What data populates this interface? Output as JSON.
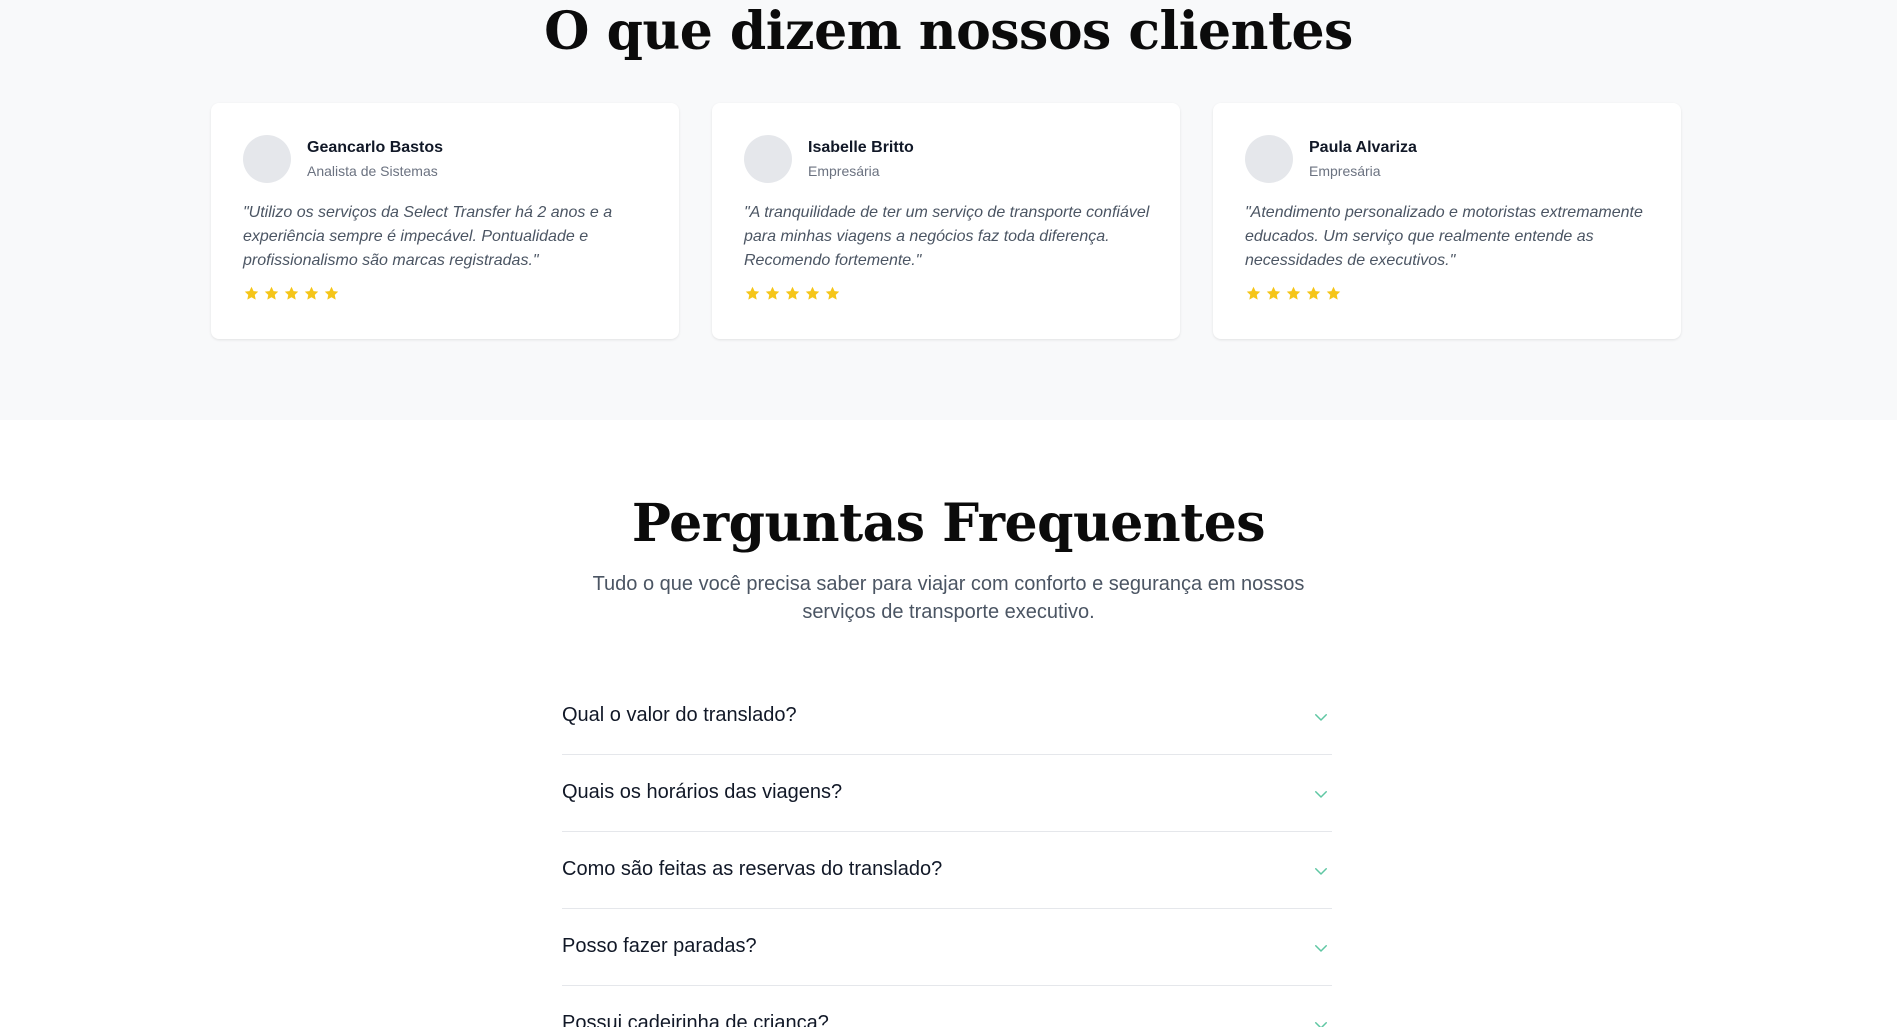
{
  "colors": {
    "star": "#f5c518",
    "chevron": "#5fc7a3",
    "testimonials_bg": "#f8f9fa"
  },
  "testimonials": {
    "title": "O que dizem nossos clientes",
    "items": [
      {
        "name": "Geancarlo Bastos",
        "role": "Analista de Sistemas",
        "quote": "\"Utilizo os serviços da Select Transfer há 2 anos e a experiência sempre é impecável. Pontualidade e profissionalismo são marcas registradas.\"",
        "rating": 5
      },
      {
        "name": "Isabelle Britto",
        "role": "Empresária",
        "quote": "\"A tranquilidade de ter um serviço de transporte confiável para minhas viagens a negócios faz toda diferença. Recomendo fortemente.\"",
        "rating": 5
      },
      {
        "name": "Paula Alvariza",
        "role": "Empresária",
        "quote": "\"Atendimento personalizado e motoristas extremamente educados. Um serviço que realmente entende as necessidades de executivos.\"",
        "rating": 5
      }
    ]
  },
  "faq": {
    "title": "Perguntas Frequentes",
    "subtitle_line1": "Tudo o que você precisa saber para viajar com conforto e segurança em nossos",
    "subtitle_line2": "serviços de transporte executivo.",
    "questions": [
      {
        "label": "Qual o valor do translado?",
        "icon": "chevron-down-icon"
      },
      {
        "label": "Quais os horários das viagens?",
        "icon": "chevron-down-icon"
      },
      {
        "label": "Como são feitas as reservas do translado?",
        "icon": "chevron-down-icon"
      },
      {
        "label": "Posso fazer paradas?",
        "icon": "chevron-down-icon"
      },
      {
        "label": "Possui cadeirinha de criança?",
        "icon": "chevron-down-icon"
      }
    ]
  }
}
